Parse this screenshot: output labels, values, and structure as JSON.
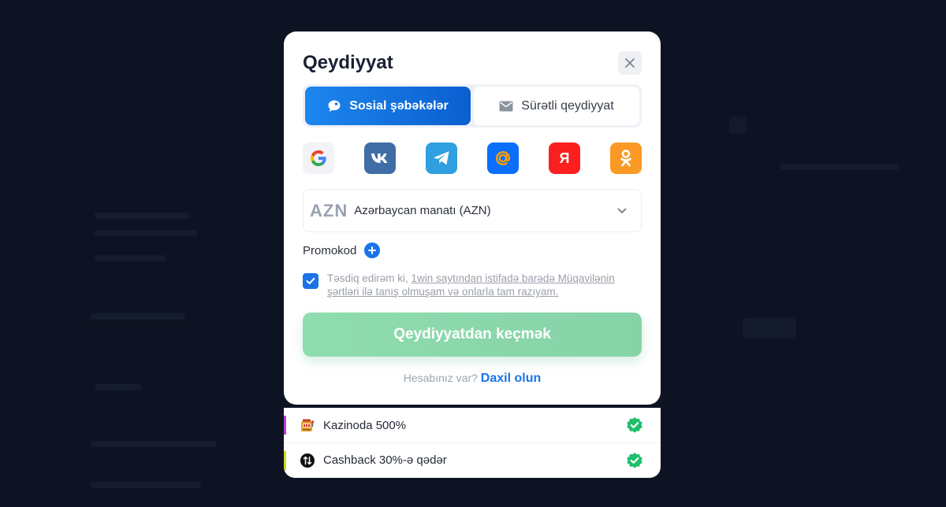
{
  "modal": {
    "title": "Qeydiyyat",
    "close_icon": "close-icon"
  },
  "tabs": [
    {
      "label": "Sosial şəbəkələr",
      "icon": "chat-bubble-icon",
      "active": true
    },
    {
      "label": "Sürətli qeydiyyat",
      "icon": "envelope-icon",
      "active": false
    }
  ],
  "socials": [
    {
      "name": "google",
      "icon": "google-icon",
      "color": "#f1f3f6"
    },
    {
      "name": "vk",
      "icon": "vk-icon",
      "color": "#3e6ea5"
    },
    {
      "name": "telegram",
      "icon": "telegram-icon",
      "color": "#2f9fe0"
    },
    {
      "name": "mail",
      "icon": "at-icon",
      "color": "#0a6ffb"
    },
    {
      "name": "yandex",
      "icon": "yandex-icon",
      "color": "#fc1f1f"
    },
    {
      "name": "odnoklassniki",
      "icon": "odnoklassniki-icon",
      "color": "#fa9a25"
    }
  ],
  "currency": {
    "code": "AZN",
    "name": "Azərbaycan manatı (AZN)"
  },
  "promo": {
    "label": "Promokod"
  },
  "agreement": {
    "checked": true,
    "prefix": "Təsdiq edirəm ki, ",
    "link_text": "1win saytından istifadə barədə Müqavilənin şərtləri ilə tanış olmuşam və onlarla tam razıyam."
  },
  "submit_label": "Qeydiyyatdan keçmək",
  "login": {
    "question": "Hesabınız var?",
    "link": "Daxil olun"
  },
  "bonuses": [
    {
      "label": "Kazinoda 500%",
      "icon": "slot-machine-icon",
      "accent": "#c13bd6"
    },
    {
      "label": "Cashback 30%-ə qədər",
      "icon": "cashback-icon",
      "accent": "#c5e01b"
    }
  ],
  "colors": {
    "primary": "#1a73e8",
    "success": "#1fbf6b",
    "submit_disabled": "#8fdcae",
    "overlay": "#0d1322"
  }
}
